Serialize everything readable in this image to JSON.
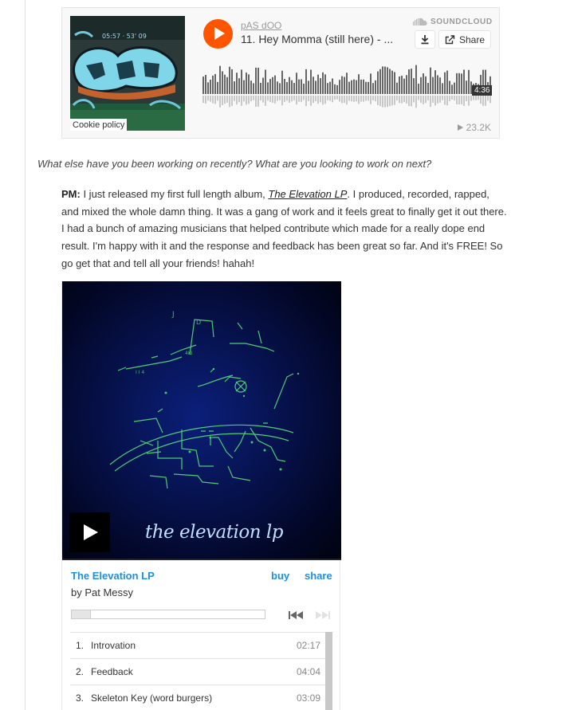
{
  "soundcloud": {
    "artist": "pAS dOO",
    "track_title": "11. Hey Momma (still here) - ...",
    "brand": "SOUNDCLOUD",
    "share_label": "Share",
    "duration": "4:36",
    "play_count": "23.2K",
    "cookie_label": "Cookie policy",
    "accent_color": "#ff5500"
  },
  "interview": {
    "question": "What else have you been working on recently? What are you looking to work on next?",
    "speaker": "PM:",
    "answer_part1": " I just released my first full length album, ",
    "album_link": "The Elevation LP",
    "answer_part2": ". I produced, recorded, rapped, and mixed the whole damn thing. It was a gang of work and it feels great to finally get it out there. I had a bunch of amazing musicians that helped contribute which made for a really dope end result. I'm happy with it and the response and feedback has been great so far. And it's FREE! So go get that and tell all your friends! hahah!"
  },
  "bandcamp": {
    "art_caption": "the elevation lp",
    "album": "The Elevation LP",
    "buy_label": "buy",
    "share_label": "share",
    "byline": "by Pat Messy",
    "link_color": "#1e8fe1",
    "tracks": [
      {
        "num": "1.",
        "title": "Introvation",
        "duration": "02:17"
      },
      {
        "num": "2.",
        "title": "Feedback",
        "duration": "04:04"
      },
      {
        "num": "3.",
        "title": "Skeleton Key (word burgers)",
        "duration": "03:09"
      }
    ]
  }
}
